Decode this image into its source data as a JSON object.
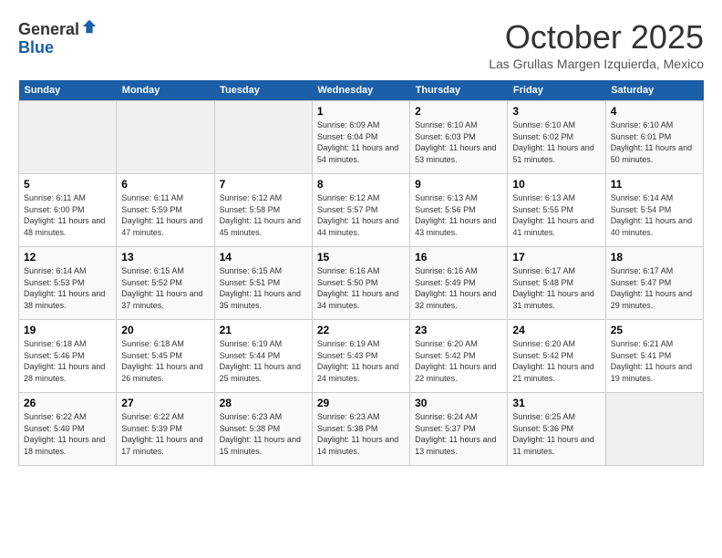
{
  "logo": {
    "general": "General",
    "blue": "Blue"
  },
  "title": "October 2025",
  "subtitle": "Las Grullas Margen Izquierda, Mexico",
  "days_of_week": [
    "Sunday",
    "Monday",
    "Tuesday",
    "Wednesday",
    "Thursday",
    "Friday",
    "Saturday"
  ],
  "weeks": [
    [
      {
        "day": "",
        "sunrise": "",
        "sunset": "",
        "daylight": ""
      },
      {
        "day": "",
        "sunrise": "",
        "sunset": "",
        "daylight": ""
      },
      {
        "day": "",
        "sunrise": "",
        "sunset": "",
        "daylight": ""
      },
      {
        "day": "1",
        "sunrise": "Sunrise: 6:09 AM",
        "sunset": "Sunset: 6:04 PM",
        "daylight": "Daylight: 11 hours and 54 minutes."
      },
      {
        "day": "2",
        "sunrise": "Sunrise: 6:10 AM",
        "sunset": "Sunset: 6:03 PM",
        "daylight": "Daylight: 11 hours and 53 minutes."
      },
      {
        "day": "3",
        "sunrise": "Sunrise: 6:10 AM",
        "sunset": "Sunset: 6:02 PM",
        "daylight": "Daylight: 11 hours and 51 minutes."
      },
      {
        "day": "4",
        "sunrise": "Sunrise: 6:10 AM",
        "sunset": "Sunset: 6:01 PM",
        "daylight": "Daylight: 11 hours and 50 minutes."
      }
    ],
    [
      {
        "day": "5",
        "sunrise": "Sunrise: 6:11 AM",
        "sunset": "Sunset: 6:00 PM",
        "daylight": "Daylight: 11 hours and 48 minutes."
      },
      {
        "day": "6",
        "sunrise": "Sunrise: 6:11 AM",
        "sunset": "Sunset: 5:59 PM",
        "daylight": "Daylight: 11 hours and 47 minutes."
      },
      {
        "day": "7",
        "sunrise": "Sunrise: 6:12 AM",
        "sunset": "Sunset: 5:58 PM",
        "daylight": "Daylight: 11 hours and 45 minutes."
      },
      {
        "day": "8",
        "sunrise": "Sunrise: 6:12 AM",
        "sunset": "Sunset: 5:57 PM",
        "daylight": "Daylight: 11 hours and 44 minutes."
      },
      {
        "day": "9",
        "sunrise": "Sunrise: 6:13 AM",
        "sunset": "Sunset: 5:56 PM",
        "daylight": "Daylight: 11 hours and 43 minutes."
      },
      {
        "day": "10",
        "sunrise": "Sunrise: 6:13 AM",
        "sunset": "Sunset: 5:55 PM",
        "daylight": "Daylight: 11 hours and 41 minutes."
      },
      {
        "day": "11",
        "sunrise": "Sunrise: 6:14 AM",
        "sunset": "Sunset: 5:54 PM",
        "daylight": "Daylight: 11 hours and 40 minutes."
      }
    ],
    [
      {
        "day": "12",
        "sunrise": "Sunrise: 6:14 AM",
        "sunset": "Sunset: 5:53 PM",
        "daylight": "Daylight: 11 hours and 38 minutes."
      },
      {
        "day": "13",
        "sunrise": "Sunrise: 6:15 AM",
        "sunset": "Sunset: 5:52 PM",
        "daylight": "Daylight: 11 hours and 37 minutes."
      },
      {
        "day": "14",
        "sunrise": "Sunrise: 6:15 AM",
        "sunset": "Sunset: 5:51 PM",
        "daylight": "Daylight: 11 hours and 35 minutes."
      },
      {
        "day": "15",
        "sunrise": "Sunrise: 6:16 AM",
        "sunset": "Sunset: 5:50 PM",
        "daylight": "Daylight: 11 hours and 34 minutes."
      },
      {
        "day": "16",
        "sunrise": "Sunrise: 6:16 AM",
        "sunset": "Sunset: 5:49 PM",
        "daylight": "Daylight: 11 hours and 32 minutes."
      },
      {
        "day": "17",
        "sunrise": "Sunrise: 6:17 AM",
        "sunset": "Sunset: 5:48 PM",
        "daylight": "Daylight: 11 hours and 31 minutes."
      },
      {
        "day": "18",
        "sunrise": "Sunrise: 6:17 AM",
        "sunset": "Sunset: 5:47 PM",
        "daylight": "Daylight: 11 hours and 29 minutes."
      }
    ],
    [
      {
        "day": "19",
        "sunrise": "Sunrise: 6:18 AM",
        "sunset": "Sunset: 5:46 PM",
        "daylight": "Daylight: 11 hours and 28 minutes."
      },
      {
        "day": "20",
        "sunrise": "Sunrise: 6:18 AM",
        "sunset": "Sunset: 5:45 PM",
        "daylight": "Daylight: 11 hours and 26 minutes."
      },
      {
        "day": "21",
        "sunrise": "Sunrise: 6:19 AM",
        "sunset": "Sunset: 5:44 PM",
        "daylight": "Daylight: 11 hours and 25 minutes."
      },
      {
        "day": "22",
        "sunrise": "Sunrise: 6:19 AM",
        "sunset": "Sunset: 5:43 PM",
        "daylight": "Daylight: 11 hours and 24 minutes."
      },
      {
        "day": "23",
        "sunrise": "Sunrise: 6:20 AM",
        "sunset": "Sunset: 5:42 PM",
        "daylight": "Daylight: 11 hours and 22 minutes."
      },
      {
        "day": "24",
        "sunrise": "Sunrise: 6:20 AM",
        "sunset": "Sunset: 5:42 PM",
        "daylight": "Daylight: 11 hours and 21 minutes."
      },
      {
        "day": "25",
        "sunrise": "Sunrise: 6:21 AM",
        "sunset": "Sunset: 5:41 PM",
        "daylight": "Daylight: 11 hours and 19 minutes."
      }
    ],
    [
      {
        "day": "26",
        "sunrise": "Sunrise: 6:22 AM",
        "sunset": "Sunset: 5:40 PM",
        "daylight": "Daylight: 11 hours and 18 minutes."
      },
      {
        "day": "27",
        "sunrise": "Sunrise: 6:22 AM",
        "sunset": "Sunset: 5:39 PM",
        "daylight": "Daylight: 11 hours and 17 minutes."
      },
      {
        "day": "28",
        "sunrise": "Sunrise: 6:23 AM",
        "sunset": "Sunset: 5:38 PM",
        "daylight": "Daylight: 11 hours and 15 minutes."
      },
      {
        "day": "29",
        "sunrise": "Sunrise: 6:23 AM",
        "sunset": "Sunset: 5:38 PM",
        "daylight": "Daylight: 11 hours and 14 minutes."
      },
      {
        "day": "30",
        "sunrise": "Sunrise: 6:24 AM",
        "sunset": "Sunset: 5:37 PM",
        "daylight": "Daylight: 11 hours and 13 minutes."
      },
      {
        "day": "31",
        "sunrise": "Sunrise: 6:25 AM",
        "sunset": "Sunset: 5:36 PM",
        "daylight": "Daylight: 11 hours and 11 minutes."
      },
      {
        "day": "",
        "sunrise": "",
        "sunset": "",
        "daylight": ""
      }
    ]
  ]
}
